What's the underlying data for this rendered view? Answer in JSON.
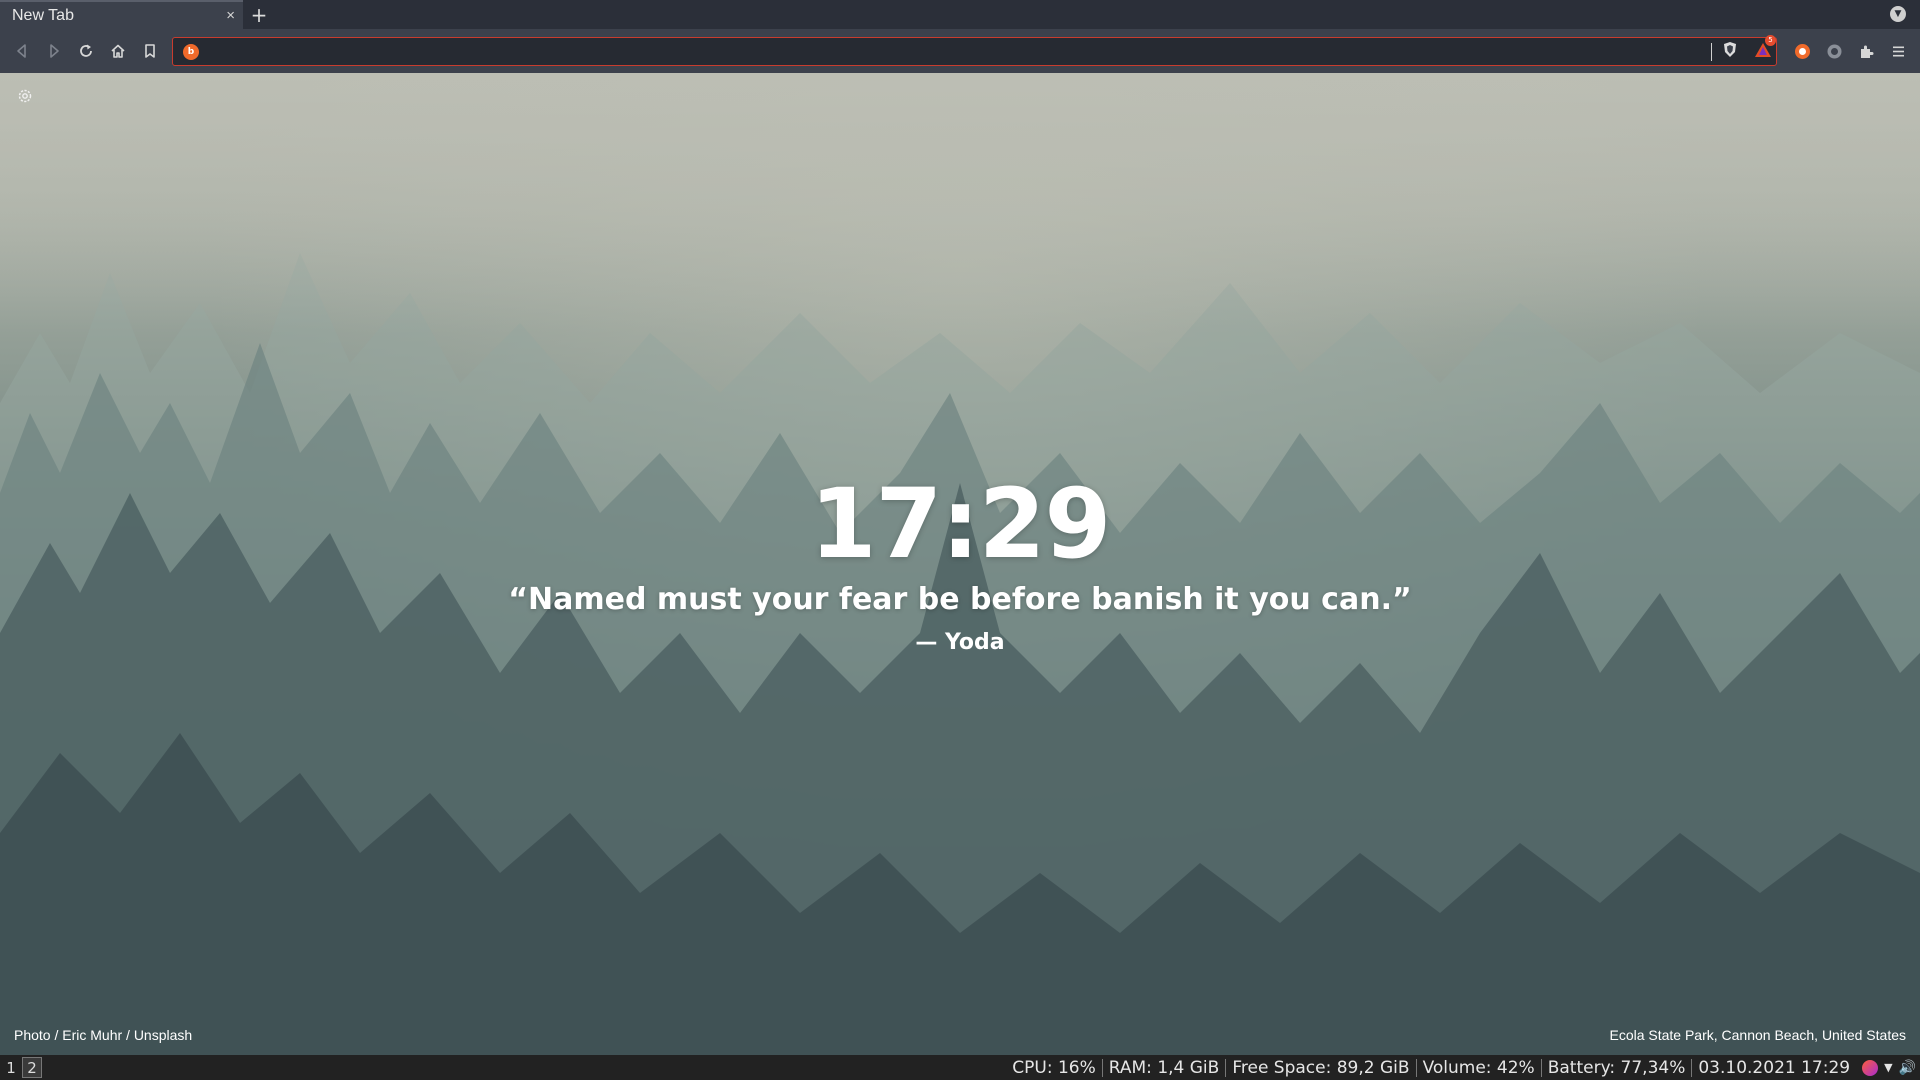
{
  "browser": {
    "tab": {
      "title": "New Tab",
      "close_glyph": "×"
    },
    "new_tab_glyph": "+",
    "address_bar": {
      "value": "",
      "placeholder": ""
    },
    "rewards_badge_count": "5",
    "accent_color": "#c83c2e"
  },
  "newtab": {
    "time": "17:29",
    "quote": "“Named must your fear be before banish it you can.”",
    "author": "— Yoda",
    "photo_credit": "Photo / Eric Muhr / Unsplash",
    "location": "Ecola State Park, Cannon Beach, United States"
  },
  "statusbar": {
    "workspaces": [
      "1",
      "2"
    ],
    "active_workspace": "2",
    "cpu": "CPU: 16%",
    "ram": "RAM: 1,4 GiB",
    "free_space": "Free Space: 89,2 GiB",
    "volume": "Volume: 42%",
    "battery": "Battery: 77,34%",
    "datetime": "03.10.2021 17:29",
    "wifi_glyph": "▼",
    "volume_glyph": "🔊"
  },
  "icons": [
    "back-icon",
    "forward-icon",
    "reload-icon",
    "home-icon",
    "bookmark-icon",
    "brave-shield-icon",
    "brave-rewards-icon",
    "extension-icon",
    "menu-icon",
    "settings-icon",
    "wifi-icon",
    "speaker-icon"
  ]
}
